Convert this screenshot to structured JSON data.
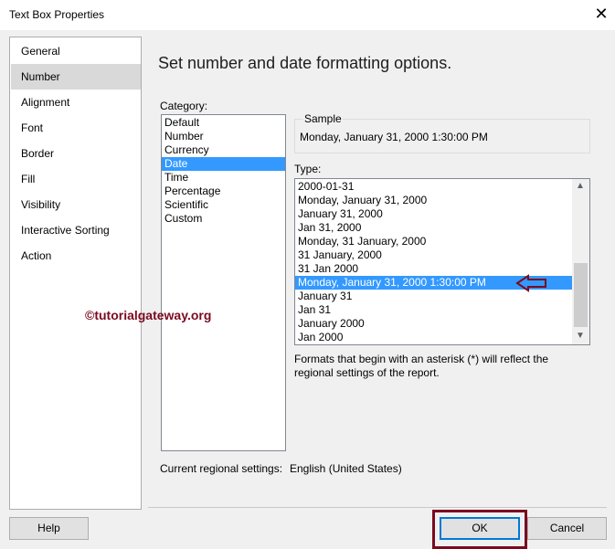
{
  "window": {
    "title": "Text Box Properties",
    "close": "✕"
  },
  "sidebar": {
    "items": [
      {
        "label": "General"
      },
      {
        "label": "Number"
      },
      {
        "label": "Alignment"
      },
      {
        "label": "Font"
      },
      {
        "label": "Border"
      },
      {
        "label": "Fill"
      },
      {
        "label": "Visibility"
      },
      {
        "label": "Interactive Sorting"
      },
      {
        "label": "Action"
      }
    ],
    "selected": "Number"
  },
  "main": {
    "heading": "Set number and date formatting options.",
    "category_label": "Category:",
    "categories": [
      "Default",
      "Number",
      "Currency",
      "Date",
      "Time",
      "Percentage",
      "Scientific",
      "Custom"
    ],
    "selected_category": "Date",
    "sample_label": "Sample",
    "sample_value": "Monday, January 31, 2000 1:30:00 PM",
    "type_label": "Type:",
    "types": [
      "2000-01-31",
      "Monday, January 31, 2000",
      "January 31, 2000",
      "Jan 31, 2000",
      "Monday, 31 January, 2000",
      "31 January, 2000",
      "31 Jan 2000",
      "Monday, January 31, 2000 1:30:00 PM",
      "January 31",
      "Jan 31",
      "January 2000",
      "Jan 2000"
    ],
    "selected_type": "Monday, January 31, 2000 1:30:00 PM",
    "note_line1": "Formats that begin with an asterisk (*) will reflect the",
    "note_line2": "regional settings of the report.",
    "regional_label": "Current regional settings:",
    "regional_value": "English (United States)"
  },
  "watermark": "©tutorialgateway.org",
  "footer": {
    "help": "Help",
    "ok": "OK",
    "cancel": "Cancel"
  },
  "colors": {
    "selection": "#3399ff",
    "annotation": "#7b0a1f"
  }
}
